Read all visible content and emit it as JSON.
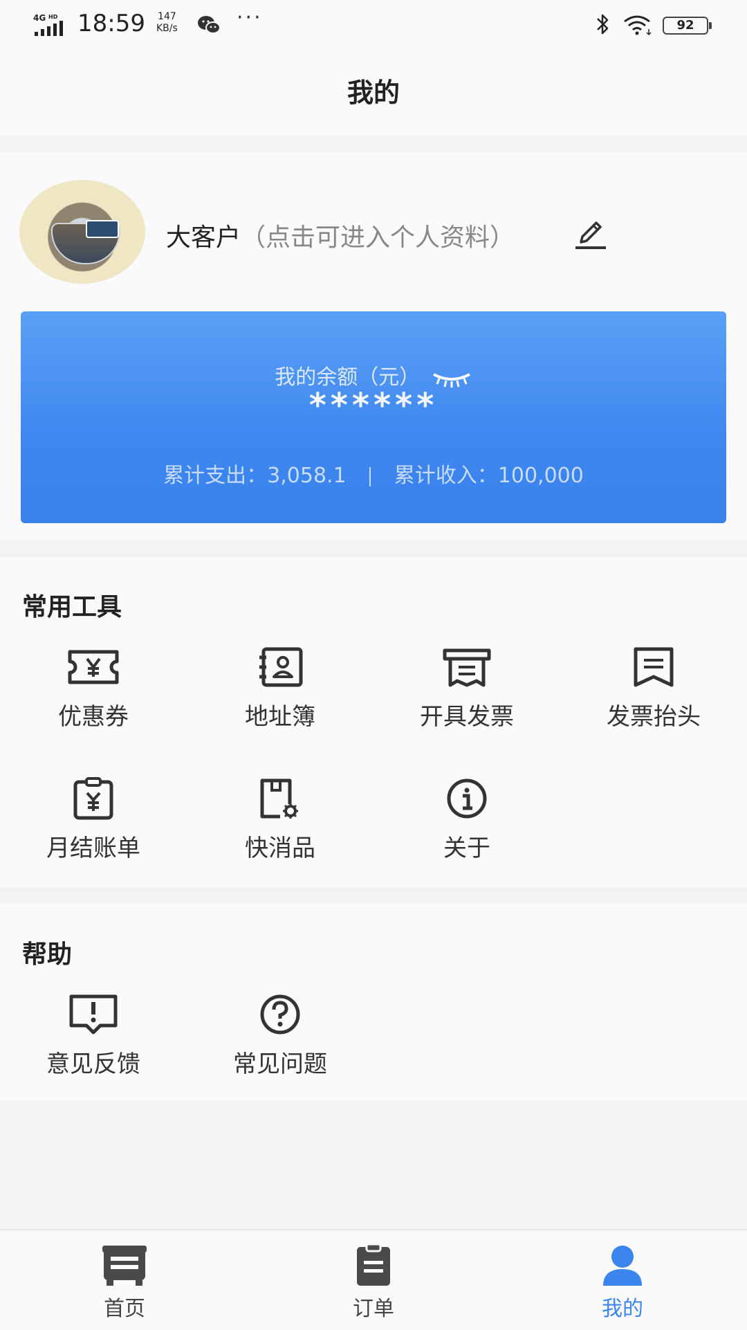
{
  "status_bar": {
    "network": "4G HD",
    "time": "18:59",
    "speed_value": "147",
    "speed_unit": "KB/s",
    "more": "···",
    "battery": "92"
  },
  "header": {
    "title": "我的"
  },
  "profile": {
    "name": "大客户",
    "hint": "（点击可进入个人资料）"
  },
  "balance": {
    "label": "我的余额（元）",
    "value": "******",
    "spend_label": "累计支出：",
    "spend_value": "3,058.1",
    "income_label": "累计收入：",
    "income_value": "100,000"
  },
  "tools": {
    "title": "常用工具",
    "items": [
      {
        "label": "优惠券",
        "icon": "coupon-icon"
      },
      {
        "label": "地址簿",
        "icon": "address-book-icon"
      },
      {
        "label": "开具发票",
        "icon": "issue-invoice-icon"
      },
      {
        "label": "发票抬头",
        "icon": "invoice-title-icon"
      },
      {
        "label": "月结账单",
        "icon": "monthly-bill-icon"
      },
      {
        "label": "快消品",
        "icon": "fmcg-icon"
      },
      {
        "label": "关于",
        "icon": "info-icon"
      }
    ]
  },
  "help": {
    "title": "帮助",
    "items": [
      {
        "label": "意见反馈",
        "icon": "feedback-icon"
      },
      {
        "label": "常见问题",
        "icon": "question-icon"
      }
    ]
  },
  "nav": {
    "items": [
      {
        "label": "首页",
        "icon": "home-icon",
        "active": false
      },
      {
        "label": "订单",
        "icon": "orders-icon",
        "active": false
      },
      {
        "label": "我的",
        "icon": "profile-icon",
        "active": true
      }
    ]
  },
  "colors": {
    "accent": "#3a86ee",
    "card_top": "#5aa0f6",
    "card_bottom": "#3a82ec"
  }
}
